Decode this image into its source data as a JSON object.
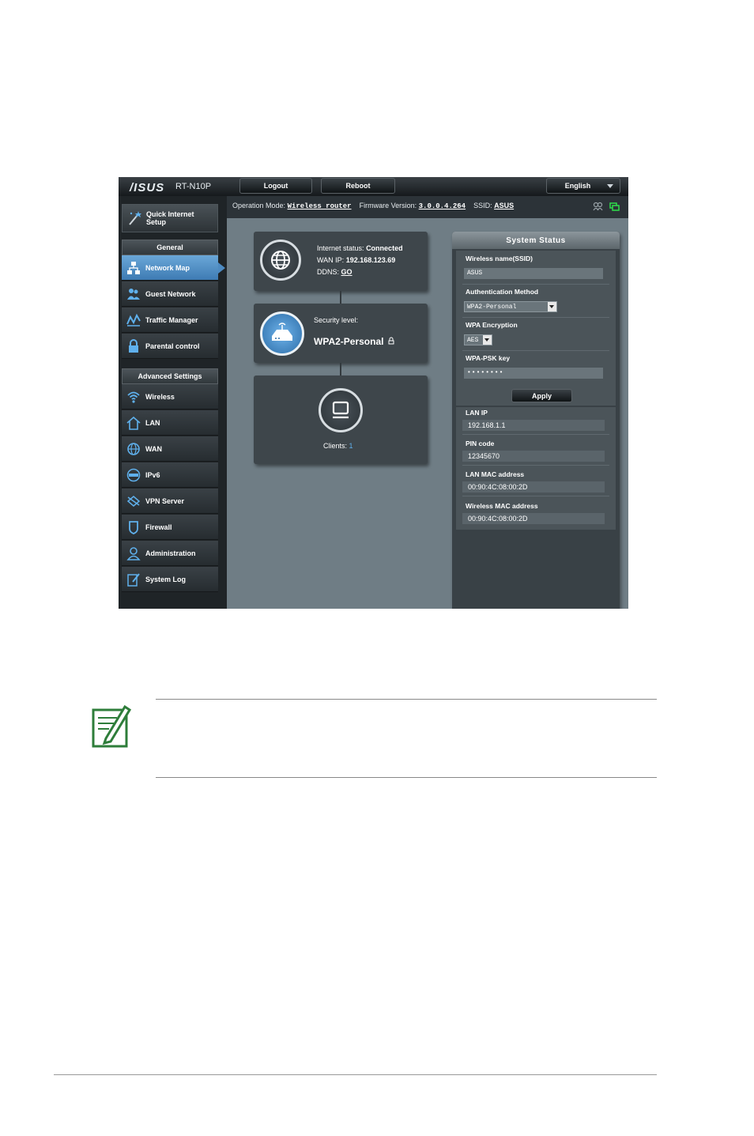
{
  "header": {
    "brand": "/ISUS",
    "model": "RT-N10P",
    "logout_label": "Logout",
    "reboot_label": "Reboot",
    "language": "English"
  },
  "status_line": {
    "op_mode_label": "Operation Mode:",
    "op_mode_value": "Wireless router",
    "firmware_label": "Firmware Version:",
    "firmware_value": "3.0.0.4.264",
    "ssid_label": "SSID:",
    "ssid_value": "ASUS"
  },
  "sidebar": {
    "quick_setup_line1": "Quick Internet",
    "quick_setup_line2": "Setup",
    "general_header": "General",
    "general_items": [
      {
        "label": "Network Map",
        "icon": "network-map-icon"
      },
      {
        "label": "Guest Network",
        "icon": "guest-network-icon"
      },
      {
        "label": "Traffic Manager",
        "icon": "traffic-manager-icon"
      },
      {
        "label": "Parental control",
        "icon": "lock-icon"
      }
    ],
    "advanced_header": "Advanced Settings",
    "advanced_items": [
      {
        "label": "Wireless",
        "icon": "wifi-icon"
      },
      {
        "label": "LAN",
        "icon": "home-icon"
      },
      {
        "label": "WAN",
        "icon": "globe-icon"
      },
      {
        "label": "IPv6",
        "icon": "ipv6-icon"
      },
      {
        "label": "VPN Server",
        "icon": "vpn-icon"
      },
      {
        "label": "Firewall",
        "icon": "shield-icon"
      },
      {
        "label": "Administration",
        "icon": "admin-icon"
      },
      {
        "label": "System Log",
        "icon": "log-icon"
      }
    ]
  },
  "map": {
    "internet_status_label": "Internet status:",
    "internet_status_value": "Connected",
    "wan_ip_label": "WAN IP:",
    "wan_ip_value": "192.168.123.69",
    "ddns_label": "DDNS:",
    "ddns_value": "GO",
    "security_label": "Security level:",
    "security_value": "WPA2-Personal",
    "clients_label": "Clients:",
    "clients_value": "1"
  },
  "system_status": {
    "title": "System Status",
    "ssid_label": "Wireless name(SSID)",
    "ssid_value": "ASUS",
    "auth_label": "Authentication Method",
    "auth_value": "WPA2-Personal",
    "enc_label": "WPA Encryption",
    "enc_value": "AES",
    "psk_label": "WPA-PSK key",
    "psk_value": "••••••••",
    "apply_label": "Apply",
    "lan_ip_label": "LAN IP",
    "lan_ip_value": "192.168.1.1",
    "pin_label": "PIN code",
    "pin_value": "12345670",
    "lan_mac_label": "LAN MAC address",
    "lan_mac_value": "00:90:4C:08:00:2D",
    "wl_mac_label": "Wireless MAC address",
    "wl_mac_value": "00:90:4C:08:00:2D"
  },
  "colors": {
    "accent_blue": "#4d8ac1",
    "note_icon_green": "#2e7d3a"
  }
}
